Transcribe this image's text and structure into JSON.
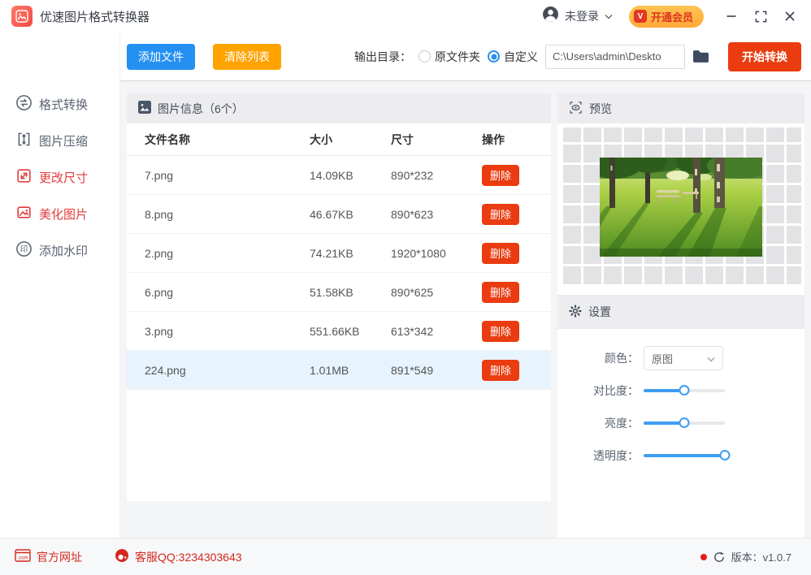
{
  "window": {
    "title": "优速图片格式转换器",
    "login_status": "未登录",
    "vip_badge": "V",
    "vip_label": "开通会员"
  },
  "toolbar": {
    "add_button": "添加文件",
    "clear_button": "清除列表",
    "output_label": "输出目录：",
    "radio_original": "原文件夹",
    "radio_custom": "自定义",
    "path_value": "C:\\Users\\admin\\Deskto",
    "start_button": "开始转换"
  },
  "sidebar": {
    "items": [
      {
        "label": "格式转换",
        "active": false
      },
      {
        "label": "图片压缩",
        "active": false
      },
      {
        "label": "更改尺寸",
        "active": true
      },
      {
        "label": "美化图片",
        "active": true
      },
      {
        "label": "添加水印",
        "active": false
      }
    ]
  },
  "table": {
    "section_title": "图片信息（6个）",
    "columns": [
      "文件名称",
      "大小",
      "尺寸",
      "操作"
    ],
    "delete_label": "删除",
    "selected_index": 5,
    "rows": [
      {
        "name": "7.png",
        "size": "14.09KB",
        "dims": "890*232"
      },
      {
        "name": "8.png",
        "size": "46.67KB",
        "dims": "890*623"
      },
      {
        "name": "2.png",
        "size": "74.21KB",
        "dims": "1920*1080"
      },
      {
        "name": "6.png",
        "size": "51.58KB",
        "dims": "890*625"
      },
      {
        "name": "3.png",
        "size": "551.66KB",
        "dims": "613*342"
      },
      {
        "name": "224.png",
        "size": "1.01MB",
        "dims": "891*549"
      }
    ]
  },
  "preview": {
    "title": "预览"
  },
  "settings": {
    "title": "设置",
    "color_label": "颜色：",
    "color_value": "原图",
    "sliders": [
      {
        "label": "对比度：",
        "value": 50
      },
      {
        "label": "亮度：",
        "value": 50
      },
      {
        "label": "透明度：",
        "value": 100
      }
    ]
  },
  "footer": {
    "website": "官方网址",
    "qq": "客服QQ:3234303643",
    "version": "版本：v1.0.7"
  },
  "colors": {
    "accent_blue": "#2490f2",
    "accent_orange": "#ffa300",
    "accent_red": "#ea3c10",
    "sidebar_active": "#e23b3b",
    "footer_red": "#d5281e",
    "slider_blue": "#3f9df1",
    "selected_row_bg": "#e7f3fd"
  }
}
